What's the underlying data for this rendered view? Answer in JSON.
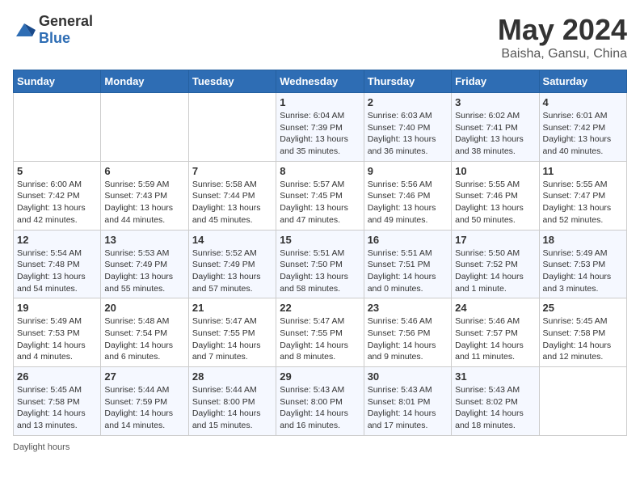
{
  "header": {
    "logo_general": "General",
    "logo_blue": "Blue",
    "month_year": "May 2024",
    "location": "Baisha, Gansu, China"
  },
  "days_of_week": [
    "Sunday",
    "Monday",
    "Tuesday",
    "Wednesday",
    "Thursday",
    "Friday",
    "Saturday"
  ],
  "weeks": [
    [
      {
        "day": "",
        "info": ""
      },
      {
        "day": "",
        "info": ""
      },
      {
        "day": "",
        "info": ""
      },
      {
        "day": "1",
        "info": "Sunrise: 6:04 AM\nSunset: 7:39 PM\nDaylight: 13 hours\nand 35 minutes."
      },
      {
        "day": "2",
        "info": "Sunrise: 6:03 AM\nSunset: 7:40 PM\nDaylight: 13 hours\nand 36 minutes."
      },
      {
        "day": "3",
        "info": "Sunrise: 6:02 AM\nSunset: 7:41 PM\nDaylight: 13 hours\nand 38 minutes."
      },
      {
        "day": "4",
        "info": "Sunrise: 6:01 AM\nSunset: 7:42 PM\nDaylight: 13 hours\nand 40 minutes."
      }
    ],
    [
      {
        "day": "5",
        "info": "Sunrise: 6:00 AM\nSunset: 7:42 PM\nDaylight: 13 hours\nand 42 minutes."
      },
      {
        "day": "6",
        "info": "Sunrise: 5:59 AM\nSunset: 7:43 PM\nDaylight: 13 hours\nand 44 minutes."
      },
      {
        "day": "7",
        "info": "Sunrise: 5:58 AM\nSunset: 7:44 PM\nDaylight: 13 hours\nand 45 minutes."
      },
      {
        "day": "8",
        "info": "Sunrise: 5:57 AM\nSunset: 7:45 PM\nDaylight: 13 hours\nand 47 minutes."
      },
      {
        "day": "9",
        "info": "Sunrise: 5:56 AM\nSunset: 7:46 PM\nDaylight: 13 hours\nand 49 minutes."
      },
      {
        "day": "10",
        "info": "Sunrise: 5:55 AM\nSunset: 7:46 PM\nDaylight: 13 hours\nand 50 minutes."
      },
      {
        "day": "11",
        "info": "Sunrise: 5:55 AM\nSunset: 7:47 PM\nDaylight: 13 hours\nand 52 minutes."
      }
    ],
    [
      {
        "day": "12",
        "info": "Sunrise: 5:54 AM\nSunset: 7:48 PM\nDaylight: 13 hours\nand 54 minutes."
      },
      {
        "day": "13",
        "info": "Sunrise: 5:53 AM\nSunset: 7:49 PM\nDaylight: 13 hours\nand 55 minutes."
      },
      {
        "day": "14",
        "info": "Sunrise: 5:52 AM\nSunset: 7:49 PM\nDaylight: 13 hours\nand 57 minutes."
      },
      {
        "day": "15",
        "info": "Sunrise: 5:51 AM\nSunset: 7:50 PM\nDaylight: 13 hours\nand 58 minutes."
      },
      {
        "day": "16",
        "info": "Sunrise: 5:51 AM\nSunset: 7:51 PM\nDaylight: 14 hours\nand 0 minutes."
      },
      {
        "day": "17",
        "info": "Sunrise: 5:50 AM\nSunset: 7:52 PM\nDaylight: 14 hours\nand 1 minute."
      },
      {
        "day": "18",
        "info": "Sunrise: 5:49 AM\nSunset: 7:53 PM\nDaylight: 14 hours\nand 3 minutes."
      }
    ],
    [
      {
        "day": "19",
        "info": "Sunrise: 5:49 AM\nSunset: 7:53 PM\nDaylight: 14 hours\nand 4 minutes."
      },
      {
        "day": "20",
        "info": "Sunrise: 5:48 AM\nSunset: 7:54 PM\nDaylight: 14 hours\nand 6 minutes."
      },
      {
        "day": "21",
        "info": "Sunrise: 5:47 AM\nSunset: 7:55 PM\nDaylight: 14 hours\nand 7 minutes."
      },
      {
        "day": "22",
        "info": "Sunrise: 5:47 AM\nSunset: 7:55 PM\nDaylight: 14 hours\nand 8 minutes."
      },
      {
        "day": "23",
        "info": "Sunrise: 5:46 AM\nSunset: 7:56 PM\nDaylight: 14 hours\nand 9 minutes."
      },
      {
        "day": "24",
        "info": "Sunrise: 5:46 AM\nSunset: 7:57 PM\nDaylight: 14 hours\nand 11 minutes."
      },
      {
        "day": "25",
        "info": "Sunrise: 5:45 AM\nSunset: 7:58 PM\nDaylight: 14 hours\nand 12 minutes."
      }
    ],
    [
      {
        "day": "26",
        "info": "Sunrise: 5:45 AM\nSunset: 7:58 PM\nDaylight: 14 hours\nand 13 minutes."
      },
      {
        "day": "27",
        "info": "Sunrise: 5:44 AM\nSunset: 7:59 PM\nDaylight: 14 hours\nand 14 minutes."
      },
      {
        "day": "28",
        "info": "Sunrise: 5:44 AM\nSunset: 8:00 PM\nDaylight: 14 hours\nand 15 minutes."
      },
      {
        "day": "29",
        "info": "Sunrise: 5:43 AM\nSunset: 8:00 PM\nDaylight: 14 hours\nand 16 minutes."
      },
      {
        "day": "30",
        "info": "Sunrise: 5:43 AM\nSunset: 8:01 PM\nDaylight: 14 hours\nand 17 minutes."
      },
      {
        "day": "31",
        "info": "Sunrise: 5:43 AM\nSunset: 8:02 PM\nDaylight: 14 hours\nand 18 minutes."
      },
      {
        "day": "",
        "info": ""
      }
    ]
  ],
  "footer": {
    "daylight_hours_label": "Daylight hours"
  }
}
